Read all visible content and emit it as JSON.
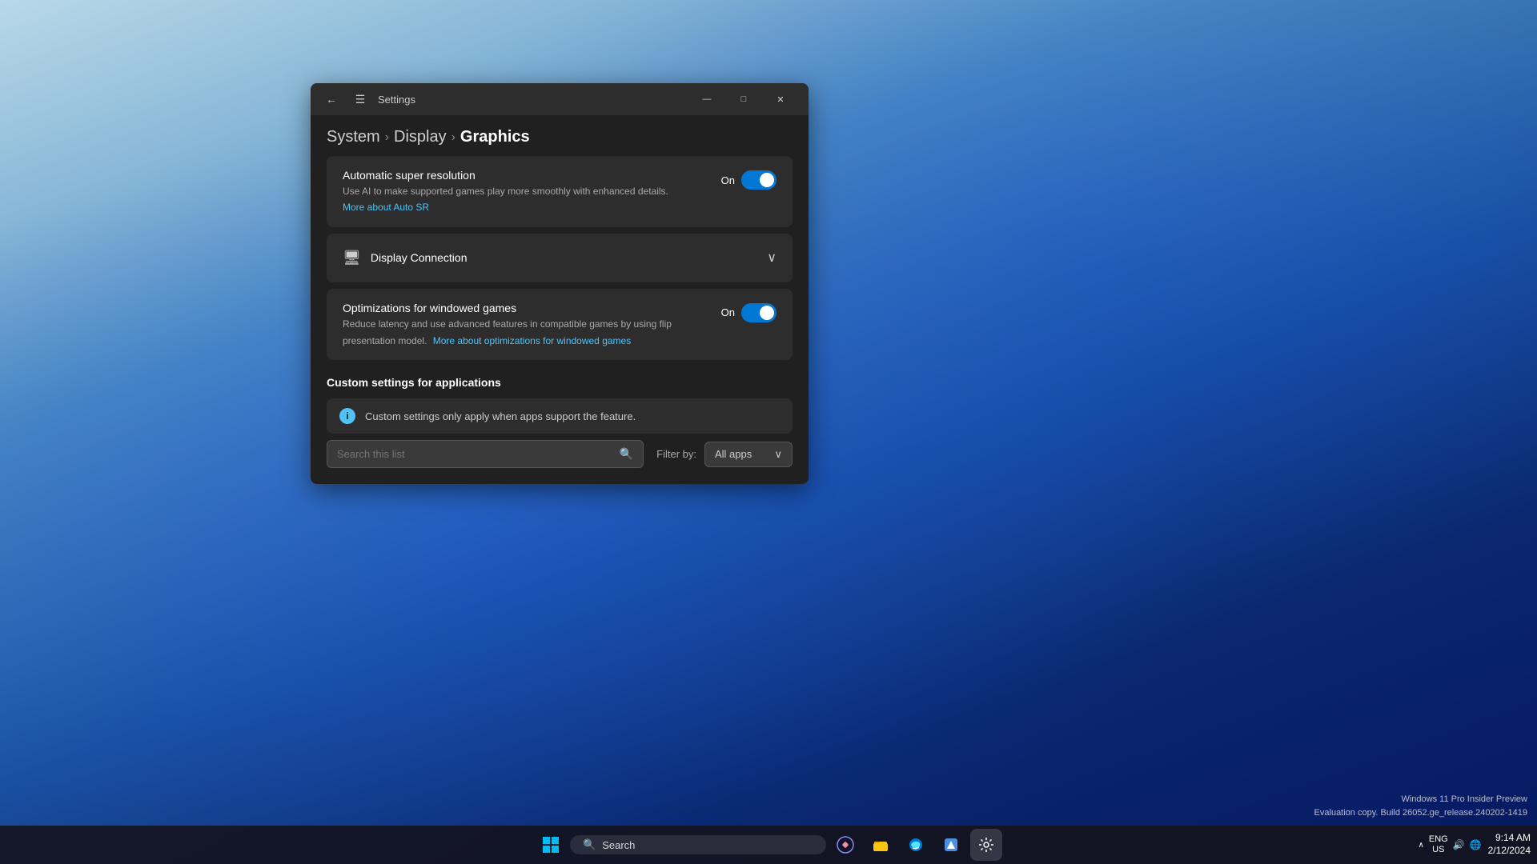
{
  "desktop": {
    "watermark_line1": "Windows 11 Pro Insider Preview",
    "watermark_line2": "Evaluation copy. Build 26052.ge_release.240202-1419"
  },
  "taskbar": {
    "search_placeholder": "Search",
    "time": "9:14 AM",
    "date": "2/12/2024",
    "lang_line1": "ENG",
    "lang_line2": "US"
  },
  "window": {
    "title": "Settings",
    "back_label": "←",
    "menu_label": "☰",
    "minimize_label": "—",
    "maximize_label": "□",
    "close_label": "✕"
  },
  "breadcrumb": {
    "system": "System",
    "sep1": "›",
    "display": "Display",
    "sep2": "›",
    "graphics": "Graphics"
  },
  "auto_sr": {
    "title": "Automatic super resolution",
    "description": "Use AI to make supported games play more smoothly with enhanced details.",
    "link_text": "More about Auto SR",
    "toggle_label": "On",
    "toggle_state": true
  },
  "display_connection": {
    "label": "Display Connection",
    "icon": "🖥"
  },
  "windowed_games": {
    "title": "Optimizations for windowed games",
    "description": "Reduce latency and use advanced features in compatible games by using flip presentation model.",
    "link_text": "More about optimizations for windowed games",
    "toggle_label": "On",
    "toggle_state": true
  },
  "custom_settings": {
    "heading": "Custom settings for applications",
    "info_text": "Custom settings only apply when apps support the feature.",
    "search_placeholder": "Search this list",
    "filter_label": "Filter by:",
    "filter_value": "All apps",
    "chevron": "∨"
  }
}
